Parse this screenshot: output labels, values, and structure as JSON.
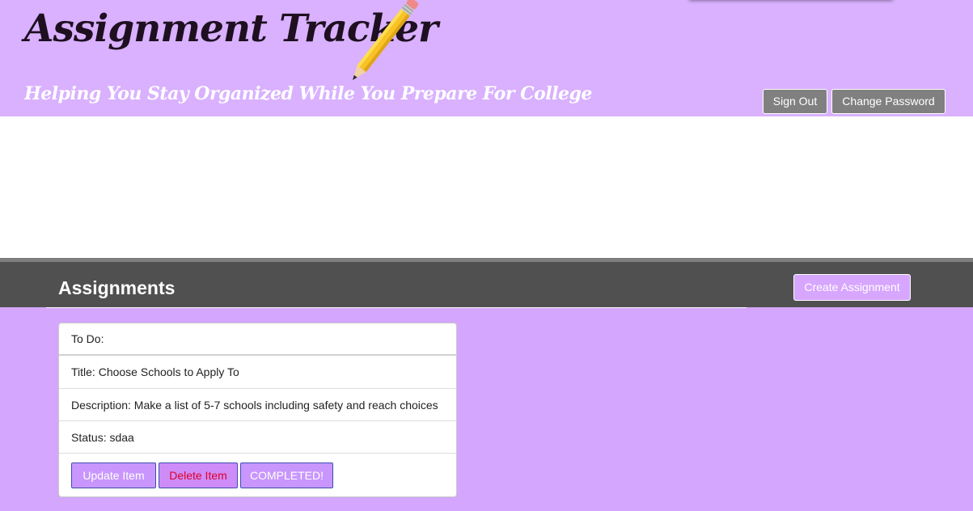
{
  "header": {
    "title": "Assignment Tracker",
    "tagline": "Helping You Stay Organized While You Prepare For College",
    "sign_out_label": "Sign Out",
    "change_password_label": "Change Password"
  },
  "assignments_section": {
    "heading": "Assignments",
    "create_label": "Create Assignment"
  },
  "assignment_card": {
    "todo_label": "To Do:",
    "title_text": "Title: Choose Schools to Apply To",
    "description_text": "Description: Make a list of 5-7 schools including safety and reach choices",
    "status_text": "Status: sdaa",
    "update_label": "Update Item",
    "delete_label": "Delete Item",
    "completed_label": "COMPLETED!"
  },
  "icons": {
    "pencil": "pencil-icon"
  },
  "colors": {
    "page_background": "#d4a6fe",
    "header_background": "#d9b1ff",
    "section_bar": "#505050",
    "header_button": "#808080",
    "delete_text": "#e0002a"
  }
}
